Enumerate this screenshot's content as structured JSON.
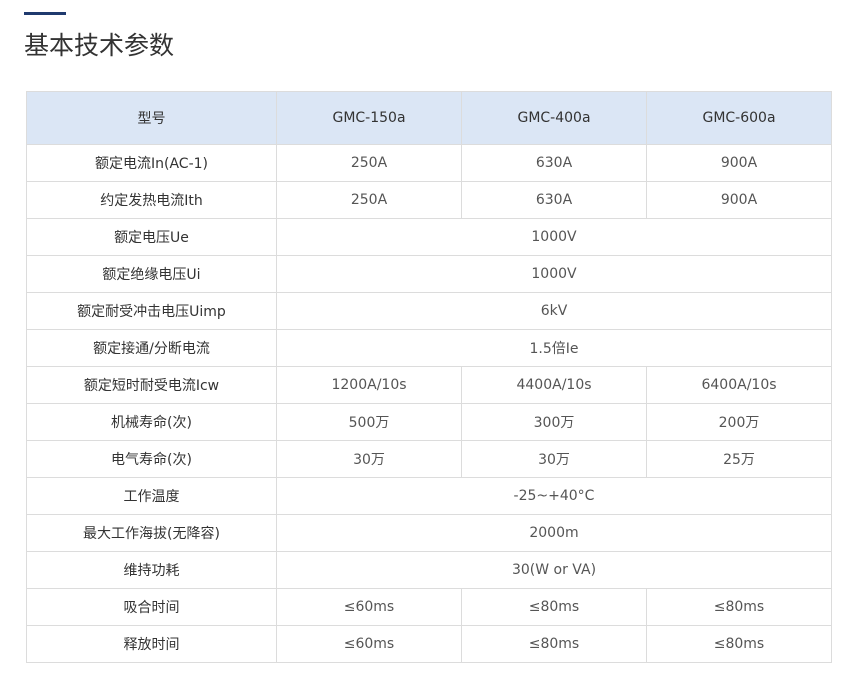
{
  "section": {
    "title": "基本技术参数"
  },
  "table": {
    "header": [
      "型号",
      "GMC-150a",
      "GMC-400a",
      "GMC-600a"
    ],
    "rows": [
      {
        "label": "额定电流In(AC-1)",
        "values": [
          "250A",
          "630A",
          "900A"
        ]
      },
      {
        "label": "约定发热电流Ith",
        "values": [
          "250A",
          "630A",
          "900A"
        ]
      },
      {
        "label": "额定电压Ue",
        "values": [
          "1000V"
        ]
      },
      {
        "label": "额定绝缘电压Ui",
        "values": [
          "1000V"
        ]
      },
      {
        "label": "额定耐受冲击电压Uimp",
        "values": [
          "6kV"
        ]
      },
      {
        "label": "额定接通/分断电流",
        "values": [
          "1.5倍Ie"
        ]
      },
      {
        "label": "额定短时耐受电流Icw",
        "values": [
          "1200A/10s",
          "4400A/10s",
          "6400A/10s"
        ]
      },
      {
        "label": "机械寿命(次)",
        "values": [
          "500万",
          "300万",
          "200万"
        ]
      },
      {
        "label": "电气寿命(次)",
        "values": [
          "30万",
          "30万",
          "25万"
        ]
      },
      {
        "label": "工作温度",
        "values": [
          "-25~+40°C"
        ]
      },
      {
        "label": "最大工作海拔(无降容)",
        "values": [
          "2000m"
        ]
      },
      {
        "label": "维持功耗",
        "values": [
          "30(W or VA)"
        ]
      },
      {
        "label": "吸合时间",
        "values": [
          "≤60ms",
          "≤80ms",
          "≤80ms"
        ]
      },
      {
        "label": "释放时间",
        "values": [
          "≤60ms",
          "≤80ms",
          "≤80ms"
        ]
      }
    ]
  }
}
